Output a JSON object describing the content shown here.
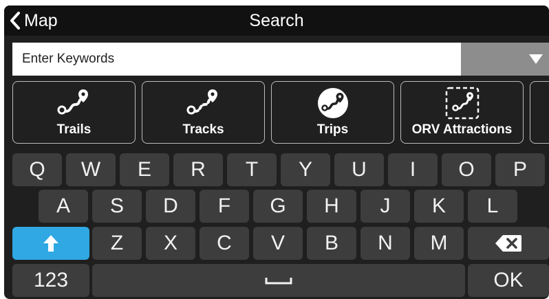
{
  "header": {
    "back_label": "Map",
    "title": "Search"
  },
  "search": {
    "placeholder": "Enter Keywords",
    "value": ""
  },
  "categories": [
    {
      "label": "Trails",
      "icon": "trails-icon"
    },
    {
      "label": "Tracks",
      "icon": "tracks-icon"
    },
    {
      "label": "Trips",
      "icon": "trips-icon"
    },
    {
      "label": "ORV Attractions",
      "icon": "orv-attractions-icon"
    }
  ],
  "keyboard": {
    "row1": [
      "Q",
      "W",
      "E",
      "R",
      "T",
      "Y",
      "U",
      "I",
      "O",
      "P"
    ],
    "row2": [
      "A",
      "S",
      "D",
      "F",
      "G",
      "H",
      "J",
      "K",
      "L"
    ],
    "row3": [
      "Z",
      "X",
      "C",
      "V",
      "B",
      "N",
      "M"
    ],
    "numbers_label": "123",
    "ok_label": "OK"
  },
  "colors": {
    "shift_accent": "#2fa8e3",
    "key_bg": "#3d3d3d",
    "header_bg": "#111111",
    "dropdown_bg": "#8d8d8d"
  }
}
